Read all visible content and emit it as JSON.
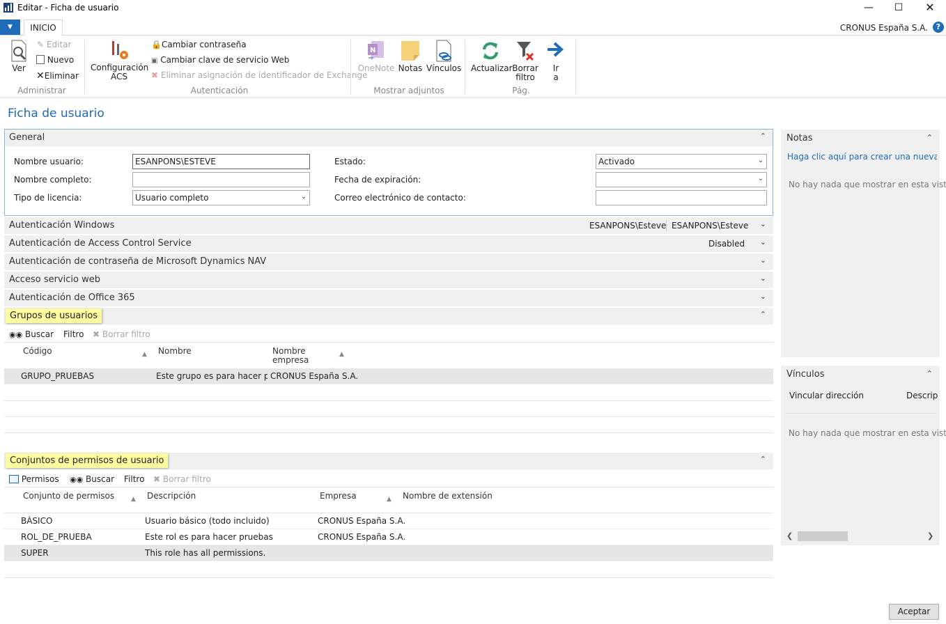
{
  "window": {
    "title": "Editar - Ficha de usuario"
  },
  "ribbon": {
    "tab": "INICIO",
    "company": "CRONUS España S.A.",
    "help": "?",
    "administrar": {
      "label": "Administrar",
      "ver": "Ver",
      "editar": "Editar",
      "nuevo": "Nuevo",
      "eliminar": "Eliminar"
    },
    "config_acs": [
      "Configuración",
      "ACS"
    ],
    "autenticacion": {
      "label": "Autenticación",
      "cambiar_contrasena": "Cambiar contraseña",
      "cambiar_clave": "Cambiar clave de servicio Web",
      "eliminar_asignacion": "Eliminar asignación de identificador de Exchange"
    },
    "adjuntos": {
      "label": "Mostrar adjuntos",
      "onenote": "OneNote",
      "notas": "Notas",
      "vinculos": "Vínculos"
    },
    "pag": {
      "label": "Pág.",
      "actualizar": "Actualizar",
      "borrar_filtro": [
        "Borrar",
        "filtro"
      ],
      "ir": [
        "Ir",
        "a"
      ]
    }
  },
  "page_title": "Ficha de usuario",
  "general": {
    "title": "General",
    "nombre_usuario_label": "Nombre usuario:",
    "nombre_usuario": "ESANPONS\\ESTEVE",
    "nombre_completo_label": "Nombre completo:",
    "nombre_completo": "",
    "tipo_licencia_label": "Tipo de licencia:",
    "tipo_licencia": "Usuario completo",
    "estado_label": "Estado:",
    "estado": "Activado",
    "fecha_expiracion_label": "Fecha de expiración:",
    "fecha_expiracion": "",
    "correo_label": "Correo electrónico de contacto:",
    "correo": ""
  },
  "sections": {
    "windows": {
      "title": "Autenticación Windows",
      "v1": "ESANPONS\\Esteve",
      "v2": "ESANPONS\\Esteve"
    },
    "acs": {
      "title": "Autenticación de Access Control Service",
      "v1": "Disabled"
    },
    "nav": {
      "title": "Autenticación de contraseña de Microsoft Dynamics NAV"
    },
    "web": {
      "title": "Acceso servicio web"
    },
    "office": {
      "title": "Autenticación de Office 365"
    }
  },
  "grupos": {
    "title": "Grupos de usuarios",
    "toolbar": {
      "buscar": "Buscar",
      "filtro": "Filtro",
      "borrar_filtro": "Borrar filtro"
    },
    "columns": {
      "codigo": "Código",
      "nombre": "Nombre",
      "empresa": [
        "Nombre",
        "empresa"
      ]
    },
    "rows": [
      {
        "codigo": "GRUPO_PRUEBAS",
        "nombre": "Este grupo es para hacer pr...",
        "empresa": "CRONUS España S.A."
      }
    ]
  },
  "permisos": {
    "title": "Conjuntos de permisos de usuario",
    "toolbar": {
      "permisos": "Permisos",
      "buscar": "Buscar",
      "filtro": "Filtro",
      "borrar_filtro": "Borrar filtro"
    },
    "columns": {
      "conjunto": "Conjunto de permisos",
      "descripcion": "Descripción",
      "empresa": "Empresa",
      "extension": "Nombre de extensión"
    },
    "rows": [
      {
        "conjunto": "BÁSICO",
        "descripcion": "Usuario básico (todo incluido)",
        "empresa": "CRONUS España S.A."
      },
      {
        "conjunto": "ROL_DE_PRUEBA",
        "descripcion": "Este rol es para hacer pruebas",
        "empresa": "CRONUS España S.A."
      },
      {
        "conjunto": "SUPER",
        "descripcion": "This role has all permissions.",
        "empresa": ""
      }
    ]
  },
  "notas": {
    "title": "Notas",
    "link": "Haga clic aquí para crear una nueva n...",
    "empty": "No hay nada que mostrar en esta vista."
  },
  "vinculos": {
    "title": "Vínculos",
    "col1": "Vincular dirección",
    "col2": "Descripc",
    "empty": "No hay nada que mostrar en esta vista."
  },
  "footer": {
    "aceptar": "Aceptar"
  }
}
